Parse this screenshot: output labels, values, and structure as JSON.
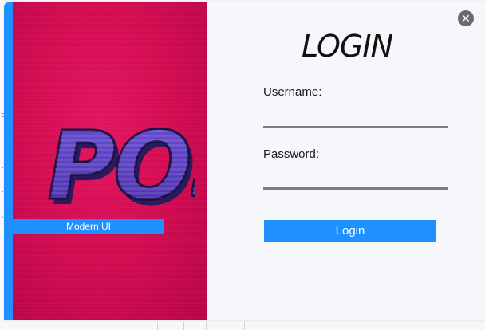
{
  "window": {
    "close_symbol": "✕",
    "close_icon": "close-icon"
  },
  "banner": {
    "logo_text": "POS",
    "tagline": "Modern UI",
    "colors": {
      "background": "#d40c52",
      "logo_fill": "#5b3fbf",
      "logo_shadow": "#2a1a5e",
      "accent": "#1e90ff"
    }
  },
  "login": {
    "title": "LOGIN",
    "username_label": "Username:",
    "username_value": "",
    "password_label": "Password:",
    "password_value": "",
    "button_label": "Login"
  }
}
